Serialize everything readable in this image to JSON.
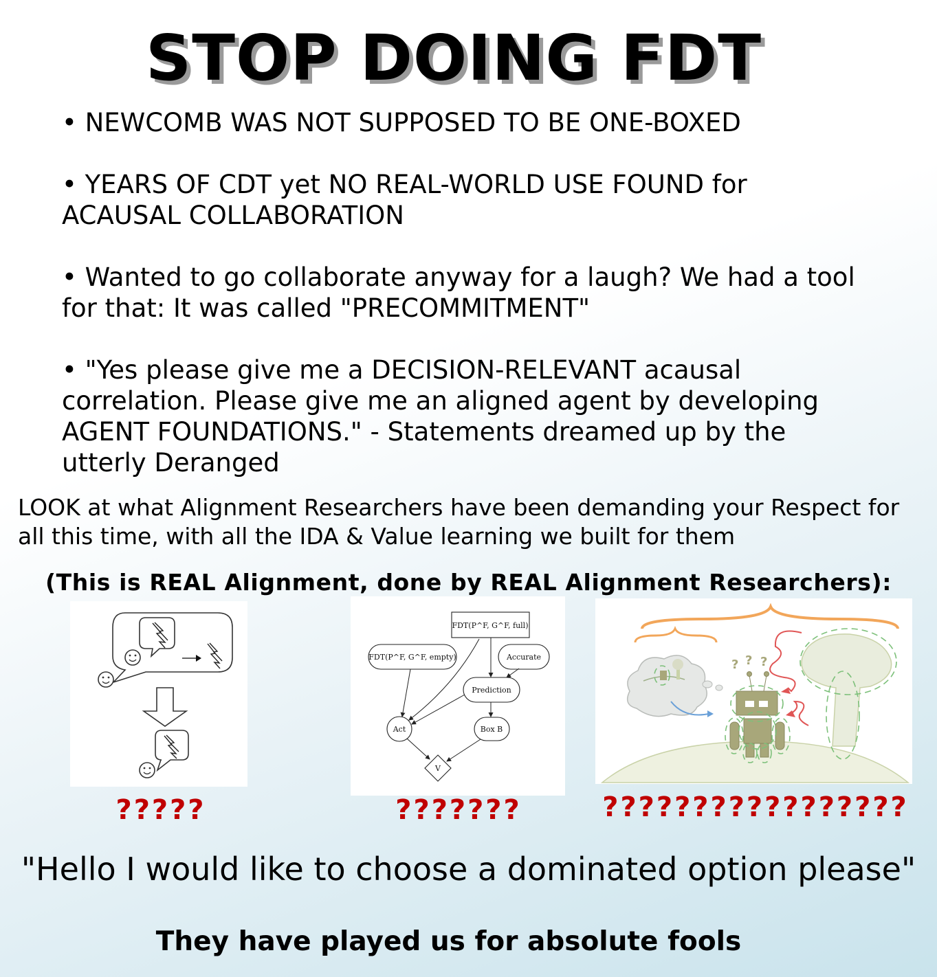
{
  "title": "STOP DOING FDT",
  "bullets": [
    "• NEWCOMB WAS NOT SUPPOSED TO BE ONE-BOXED",
    "• YEARS OF CDT yet NO REAL-WORLD USE FOUND for ACAUSAL COLLABORATION",
    "• Wanted to go collaborate anyway for a laugh? We had a tool for that: It was called \"PRECOMMITMENT\"",
    "• \"Yes please give me a DECISION-RELEVANT acausal correlation. Please give me an aligned agent by developing AGENT FOUNDATIONS.\" - Statements dreamed up by the utterly Deranged"
  ],
  "intro": "LOOK at what Alignment Researchers have been demanding your Respect for all this time, with all the IDA & Value learning we built for them",
  "real_heading": "(This is REAL Alignment, done by REAL Alignment Researchers):",
  "panels": {
    "diagram": {
      "nodes": {
        "fdt_full": "FDT(P^F, G^F, full)",
        "fdt_empty": "FDT(P^F, G^F, empty)",
        "accurate": "Accurate",
        "prediction": "Prediction",
        "act": "Act",
        "box_b": "Box B",
        "v": "V"
      }
    },
    "question_marks": [
      "?????",
      "???????",
      "?????????????????"
    ]
  },
  "quote": "\"Hello I would like to choose a dominated option please\"",
  "closing": "They have played us for absolute fools",
  "colors": {
    "question_marks": "#c00000",
    "robot": "#a8a77a",
    "dashed_outline": "#7dc07a",
    "brace": "#f2a65a",
    "squiggle": "#e05555",
    "arrow_blue": "#6aa0d8"
  }
}
